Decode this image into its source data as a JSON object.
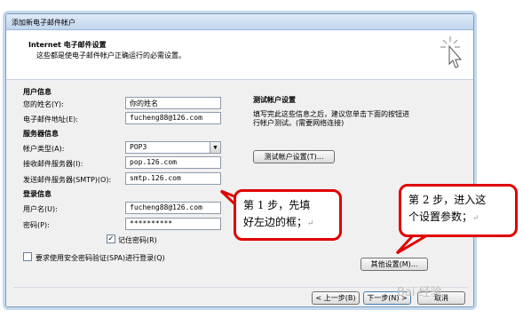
{
  "window": {
    "title": "添加新电子邮件帐户"
  },
  "header": {
    "title": "Internet 电子邮件设置",
    "subtitle": "这些都是使电子邮件帐户正确运行的必需设置。"
  },
  "user_info": {
    "heading": "用户信息",
    "name_label": "您的姓名(Y):",
    "name_value": "你的姓名",
    "email_label": "电子邮件地址(E):",
    "email_value": "fucheng88@126.com"
  },
  "server_info": {
    "heading": "服务器信息",
    "account_type_label": "帐户类型(A):",
    "account_type_value": "POP3",
    "incoming_label": "接收邮件服务器(I):",
    "incoming_value": "pop.126.com",
    "outgoing_label": "发送邮件服务器(SMTP)(O):",
    "outgoing_value": "smtp.126.com"
  },
  "login_info": {
    "heading": "登录信息",
    "username_label": "用户名(U):",
    "username_value": "fucheng88@126.com",
    "password_label": "密码(P):",
    "password_value": "**********",
    "remember_label": "记住密码(R)",
    "remember_checked": "✓",
    "spa_label": "要求使用安全密码验证(SPA)进行登录(Q)"
  },
  "test_settings": {
    "heading": "测试帐户设置",
    "description_line1": "填写完此这些信息之后，建议您单击下面的按钮进",
    "description_line2": "行帐户测试。(需要网络连接)",
    "test_button": "测试帐户设置(T)..."
  },
  "buttons": {
    "more_settings": "其他设置(M)...",
    "back": "< 上一步(B)",
    "next": "下一步(N) >",
    "cancel": "取消"
  },
  "callouts": {
    "step1_line1": "第 1 步，先填",
    "step1_line2": "好左边的框；",
    "step2_line1": "第 2 步，进入这",
    "step2_line2": "个设置参数；",
    "return_mark": "↵"
  },
  "watermark": "Bai 经验",
  "colors": {
    "callout_border": "#e00000",
    "window_border": "#7f9db9"
  }
}
